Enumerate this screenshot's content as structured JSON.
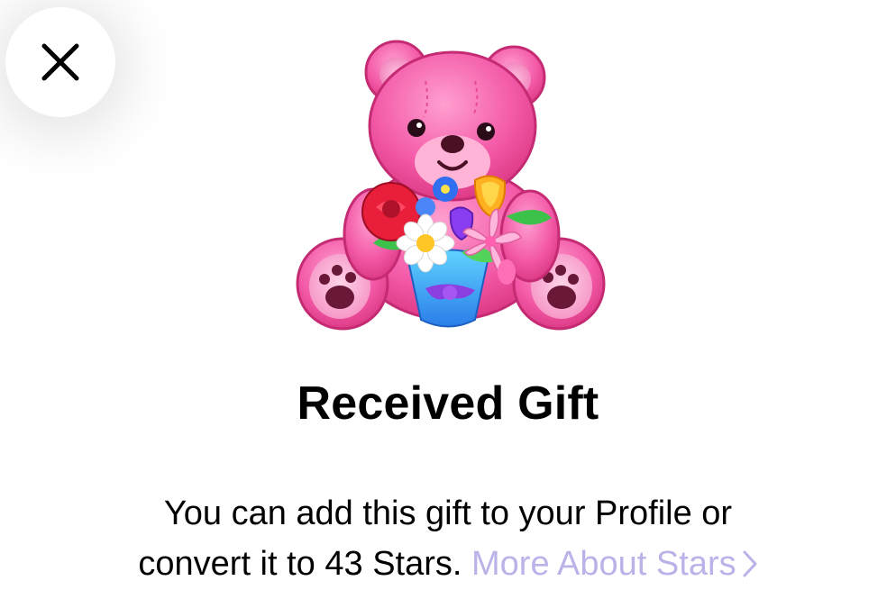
{
  "sheet": {
    "title": "Received Gift",
    "description_line1": "You can add this gift to your Profile or",
    "description_line2": "convert it to 43 Stars.",
    "more_link_label": "More About Stars",
    "stars_amount": 43
  },
  "icons": {
    "close": "close-icon",
    "gift": "teddy-bear-gift-icon",
    "chevron": "chevron-right-icon"
  },
  "colors": {
    "link": "#b9b3e8",
    "text": "#000000",
    "background": "#ffffff",
    "bear_pink": "#f25aa4"
  }
}
